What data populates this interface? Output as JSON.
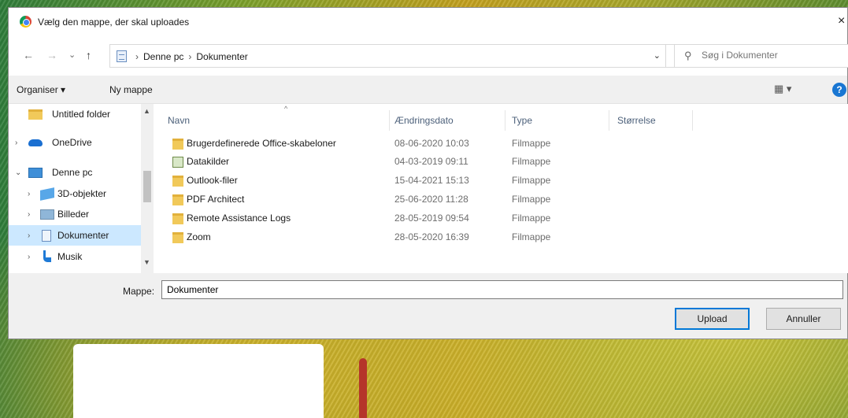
{
  "window": {
    "title": "Vælg den mappe, der skal uploades",
    "close_glyph": "×"
  },
  "navigation": {
    "back": "←",
    "forward": "→",
    "recent": "⌄",
    "up": "↑",
    "breadcrumb": [
      "Denne pc",
      "Dokumenter"
    ],
    "breadcrumb_separator": "›",
    "address_dropdown": "⌄",
    "refresh": "↻",
    "search_placeholder": "Søg i Dokumenter"
  },
  "toolbar": {
    "organise_label": "Organiser ▾",
    "new_folder_label": "Ny mappe",
    "view_label": "▦ ▾",
    "help_label": "?"
  },
  "nav_pane": {
    "items": [
      {
        "label": "Untitled folder",
        "icon": "folder-icon",
        "expander": ""
      },
      {
        "label": "OneDrive",
        "icon": "onedrive-icon",
        "expander": "›"
      },
      {
        "label": "Denne pc",
        "icon": "computer-icon",
        "expander": "⌄"
      },
      {
        "label": "3D-objekter",
        "icon": "3d-objects-icon",
        "expander": "›"
      },
      {
        "label": "Billeder",
        "icon": "pictures-icon",
        "expander": "›"
      },
      {
        "label": "Dokumenter",
        "icon": "documents-icon",
        "expander": "›",
        "selected": true
      },
      {
        "label": "Musik",
        "icon": "music-icon",
        "expander": "›"
      }
    ]
  },
  "file_list": {
    "columns": [
      "Navn",
      "Ændringsdato",
      "Type",
      "Størrelse"
    ],
    "sort_indicator": "^",
    "rows": [
      {
        "name": "Brugerdefinerede Office-skabeloner",
        "date": "08-06-2020 10:03",
        "type": "Filmappe",
        "icon": "folder-icon"
      },
      {
        "name": "Datakilder",
        "date": "04-03-2019 09:11",
        "type": "Filmappe",
        "icon": "data-sources-icon"
      },
      {
        "name": "Outlook-filer",
        "date": "15-04-2021 15:13",
        "type": "Filmappe",
        "icon": "folder-icon"
      },
      {
        "name": "PDF Architect",
        "date": "25-06-2020 11:28",
        "type": "Filmappe",
        "icon": "folder-icon"
      },
      {
        "name": "Remote Assistance Logs",
        "date": "28-05-2019 09:54",
        "type": "Filmappe",
        "icon": "folder-icon"
      },
      {
        "name": "Zoom",
        "date": "28-05-2020 16:39",
        "type": "Filmappe",
        "icon": "folder-icon"
      }
    ]
  },
  "footer": {
    "folder_label": "Mappe:",
    "folder_value": "Dokumenter",
    "upload_label": "Upload",
    "cancel_label": "Annuller"
  },
  "colors": {
    "selection": "#cce8ff",
    "primary_border": "#0078d7",
    "folder": "#f1c95a"
  }
}
